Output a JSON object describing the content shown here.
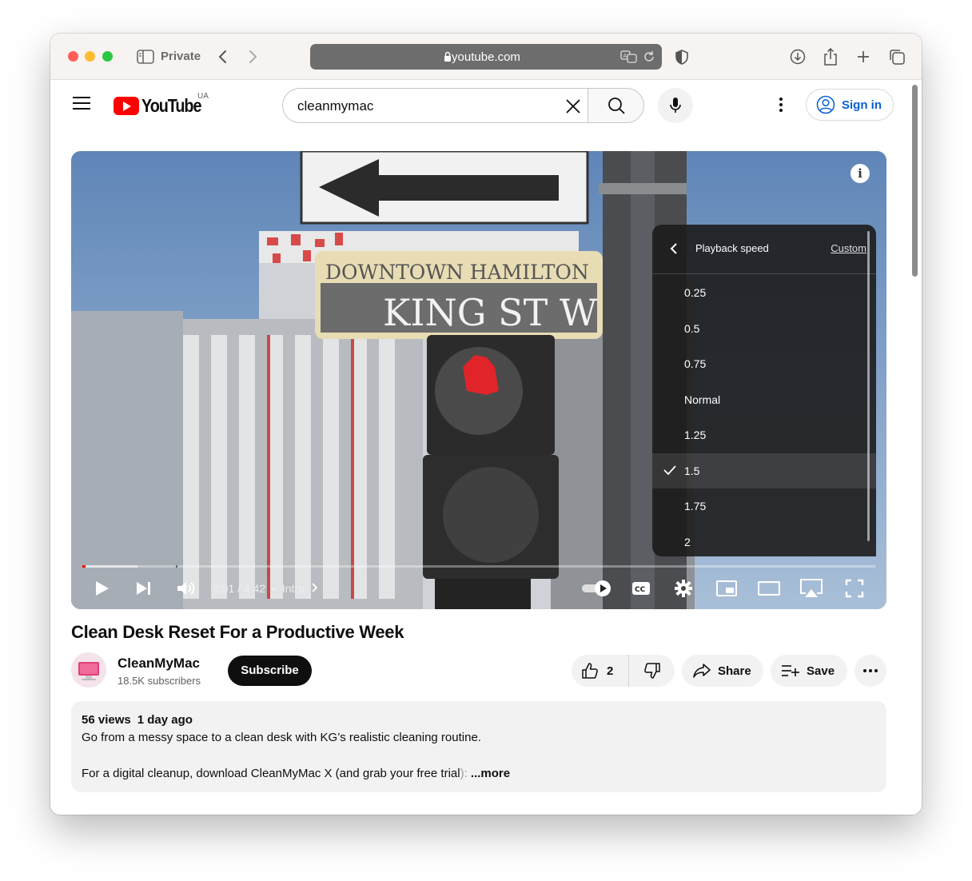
{
  "browser": {
    "private_label": "Private",
    "url": "youtube.com"
  },
  "youtube": {
    "country_code": "UA",
    "logo_text": "YouTube",
    "search_query": "cleanmymac",
    "sign_in_label": "Sign in"
  },
  "player": {
    "current_time": "0:01",
    "duration": "4:42",
    "time_separator": "/",
    "chapter": "Intro",
    "progress_fraction": 0.004,
    "buffered_fraction": 0.07,
    "autoplay_on": true,
    "speed_menu": {
      "title": "Playback speed",
      "custom_label": "Custom",
      "options": [
        "0.25",
        "0.5",
        "0.75",
        "Normal",
        "1.25",
        "1.5",
        "1.75",
        "2"
      ],
      "selected": "1.5"
    },
    "scene_sign_line1": "DOWNTOWN HAMILTON",
    "scene_sign_line2": "KING ST W"
  },
  "video": {
    "title": "Clean Desk Reset For a Productive Week",
    "channel_name": "CleanMyMac",
    "subscribers": "18.5K subscribers",
    "subscribe_label": "Subscribe",
    "like_count": "2",
    "share_label": "Share",
    "save_label": "Save",
    "views": "56 views",
    "uploaded": "1 day ago",
    "description_line1": "Go from a messy space to a clean desk with KG’s realistic cleaning routine.",
    "description_line2": "For a digital cleanup, download CleanMyMac X (and grab your free trial",
    "description_line2_faded": "):",
    "more_label": "...more"
  },
  "colors": {
    "yt_red": "#ff0000",
    "link_blue": "#065fd4",
    "menu_bg": "#1c1c1c"
  }
}
